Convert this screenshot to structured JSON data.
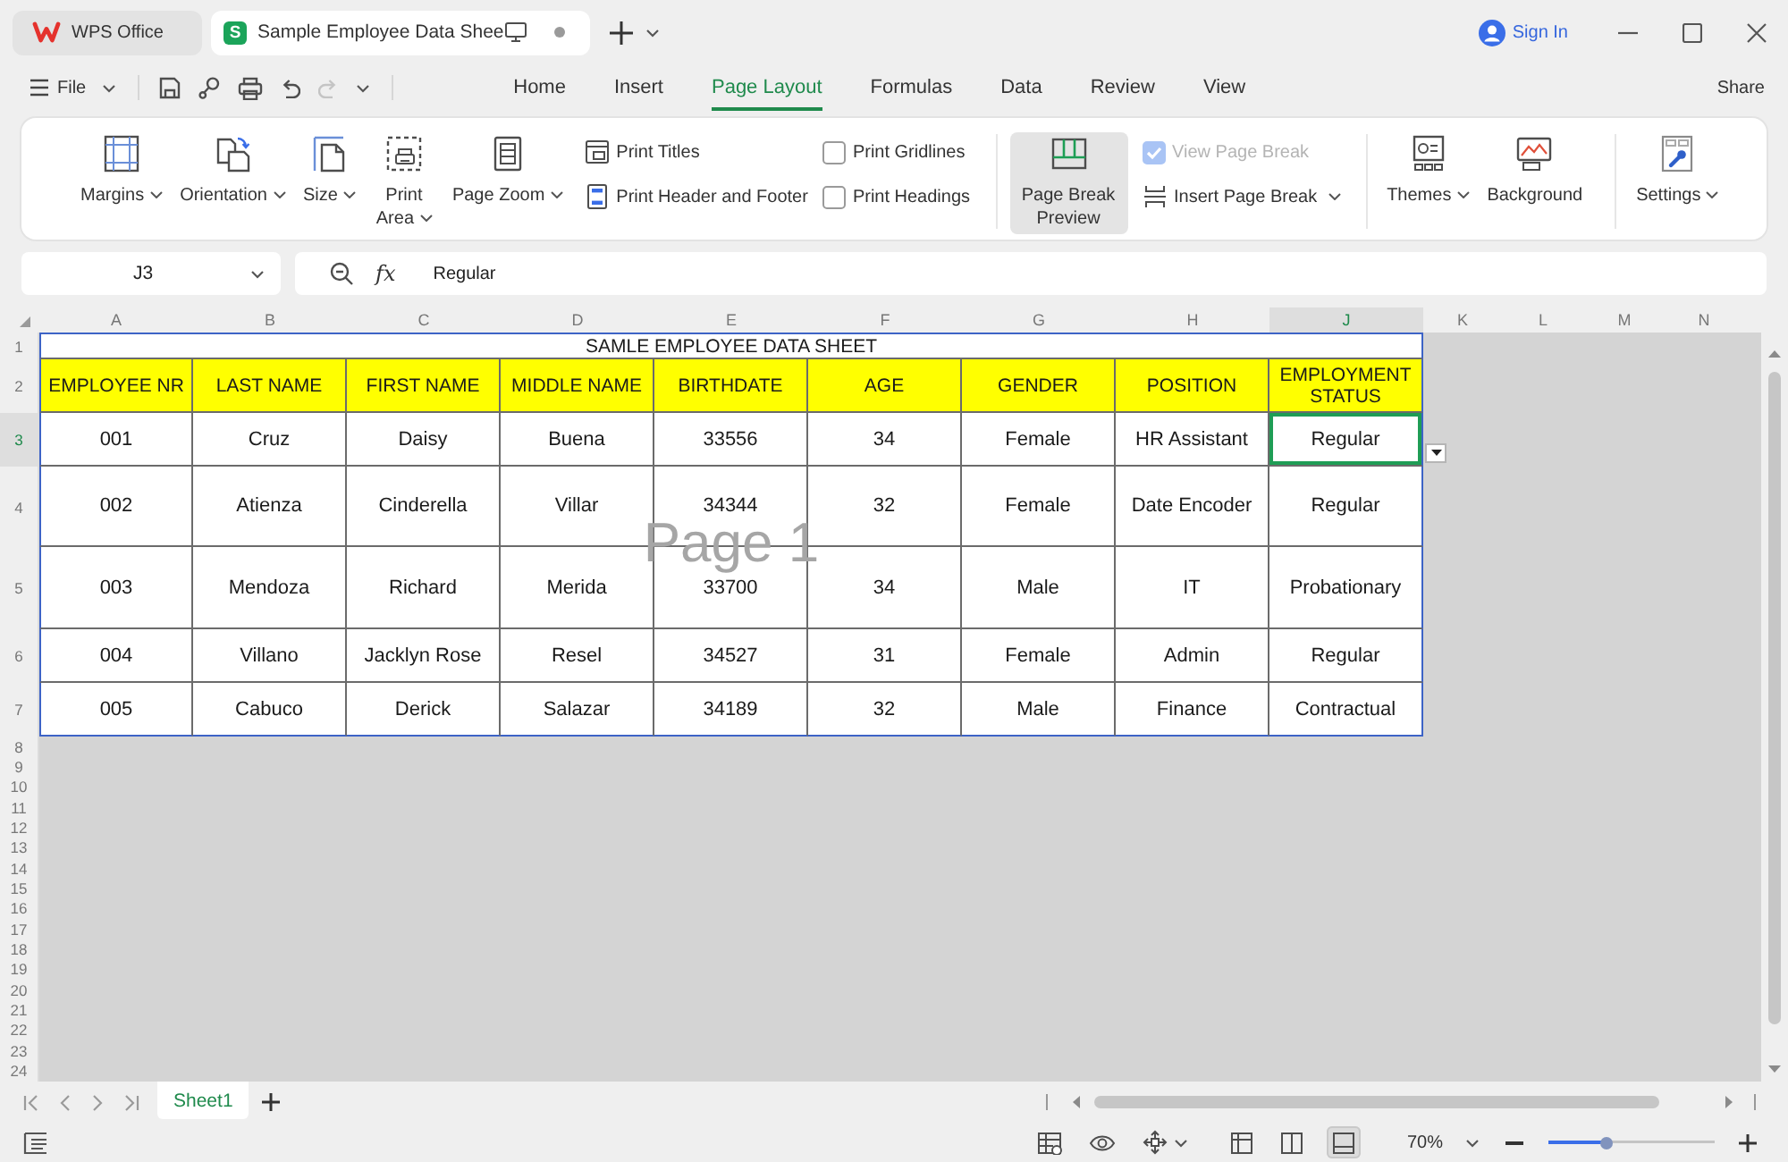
{
  "title_bar": {
    "tabs": [
      {
        "kind": "home",
        "label": "WPS Office",
        "selected": false
      },
      {
        "kind": "document",
        "badge": "S",
        "label": "Sample Employee Data Shee",
        "unsaved": true,
        "selected": true
      }
    ],
    "account": "Sign In"
  },
  "menu_bar": {
    "file": "File",
    "quick_access": [
      {
        "disabled": false
      },
      {
        "disabled": false
      },
      {
        "disabled": false
      },
      {
        "disabled": false
      },
      {
        "disabled": true
      }
    ],
    "tabs": [
      {
        "label": "Home",
        "selected": false
      },
      {
        "label": "Insert",
        "selected": false
      },
      {
        "label": "Page Layout",
        "selected": true
      },
      {
        "label": "Formulas",
        "selected": false
      },
      {
        "label": "Data",
        "selected": false
      },
      {
        "label": "Review",
        "selected": false
      },
      {
        "label": "View",
        "selected": false
      }
    ],
    "share": "Share"
  },
  "ribbon": {
    "sections": [
      {
        "controls": [
          {
            "kind": "large",
            "label": "Margins",
            "dropdown": true,
            "selected": false
          },
          {
            "kind": "large",
            "label": "Orientation",
            "dropdown": true,
            "selected": false
          },
          {
            "kind": "large",
            "label": "Size",
            "dropdown": true,
            "selected": false
          },
          {
            "kind": "large",
            "label": "Print Area",
            "dropdown": true,
            "selected": false
          },
          {
            "kind": "large",
            "label": "Page Zoom",
            "dropdown": true,
            "selected": false
          },
          {
            "kind": "stack",
            "items": [
              {
                "kind": "small",
                "label": "Print Titles",
                "dropdown": false
              },
              {
                "kind": "small",
                "label": "Print Header and Footer",
                "dropdown": false
              }
            ]
          },
          {
            "kind": "stack",
            "items": [
              {
                "kind": "checkbox",
                "label": "Print Gridlines",
                "checked": false,
                "disabled": false
              },
              {
                "kind": "checkbox",
                "label": "Print Headings",
                "checked": false,
                "disabled": false
              }
            ]
          }
        ]
      },
      {
        "controls": [
          {
            "kind": "large",
            "label": "Page Break Preview",
            "dropdown": false,
            "selected": true
          },
          {
            "kind": "stack",
            "items": [
              {
                "kind": "checkbox",
                "label": "View Page Break",
                "checked": true,
                "disabled": true
              },
              {
                "kind": "small",
                "label": "Insert Page Break",
                "dropdown": true
              }
            ]
          }
        ]
      },
      {
        "controls": [
          {
            "kind": "large",
            "label": "Themes",
            "dropdown": true,
            "selected": false
          },
          {
            "kind": "large",
            "label": "Background",
            "dropdown": false,
            "selected": false
          }
        ]
      },
      {
        "controls": [
          {
            "kind": "large",
            "label": "Settings",
            "dropdown": true,
            "selected": false
          }
        ]
      }
    ]
  },
  "formula_bar": {
    "cell_name": "J3",
    "function_label": "fx",
    "value": "Regular"
  },
  "sheet": {
    "columns": [
      {
        "label": "A",
        "selected": false
      },
      {
        "label": "B",
        "selected": false
      },
      {
        "label": "C",
        "selected": false
      },
      {
        "label": "D",
        "selected": false
      },
      {
        "label": "E",
        "selected": false
      },
      {
        "label": "F",
        "selected": false
      },
      {
        "label": "G",
        "selected": false
      },
      {
        "label": "H",
        "selected": false
      },
      {
        "label": "J",
        "selected": true
      },
      {
        "label": "K",
        "selected": false
      },
      {
        "label": "L",
        "selected": false
      },
      {
        "label": "M",
        "selected": false
      },
      {
        "label": "N",
        "selected": false
      }
    ],
    "rows": [
      {
        "label": "1",
        "selected": false
      },
      {
        "label": "2",
        "selected": false
      },
      {
        "label": "3",
        "selected": true
      },
      {
        "label": "4",
        "selected": false
      },
      {
        "label": "5",
        "selected": false
      },
      {
        "label": "6",
        "selected": false
      },
      {
        "label": "7",
        "selected": false
      },
      {
        "label": "8",
        "selected": false
      },
      {
        "label": "9",
        "selected": false
      },
      {
        "label": "10",
        "selected": false
      },
      {
        "label": "11",
        "selected": false
      },
      {
        "label": "12",
        "selected": false
      },
      {
        "label": "13",
        "selected": false
      },
      {
        "label": "14",
        "selected": false
      },
      {
        "label": "15",
        "selected": false
      },
      {
        "label": "16",
        "selected": false
      },
      {
        "label": "17",
        "selected": false
      },
      {
        "label": "18",
        "selected": false
      },
      {
        "label": "19",
        "selected": false
      },
      {
        "label": "20",
        "selected": false
      },
      {
        "label": "21",
        "selected": false
      },
      {
        "label": "22",
        "selected": false
      },
      {
        "label": "23",
        "selected": false
      },
      {
        "label": "24",
        "selected": false
      }
    ],
    "title": "SAMLE EMPLOYEE DATA SHEET",
    "header": [
      "EMPLOYEE NR",
      "LAST NAME",
      "FIRST NAME",
      "MIDDLE NAME",
      "BIRTHDATE",
      "AGE",
      "GENDER",
      "POSITION",
      "EMPLOYMENT STATUS"
    ],
    "records": [
      {
        "cells": [
          {
            "text": "001",
            "selected": false
          },
          {
            "text": "Cruz",
            "selected": false
          },
          {
            "text": "Daisy",
            "selected": false
          },
          {
            "text": "Buena",
            "selected": false
          },
          {
            "text": "33556",
            "selected": false
          },
          {
            "text": "34",
            "selected": false
          },
          {
            "text": "Female",
            "selected": false
          },
          {
            "text": "HR Assistant",
            "selected": false
          },
          {
            "text": "Regular",
            "selected": true
          }
        ]
      },
      {
        "cells": [
          {
            "text": "002",
            "selected": false
          },
          {
            "text": "Atienza",
            "selected": false
          },
          {
            "text": "Cinderella",
            "selected": false
          },
          {
            "text": "Villar",
            "selected": false
          },
          {
            "text": "34344",
            "selected": false
          },
          {
            "text": "32",
            "selected": false
          },
          {
            "text": "Female",
            "selected": false
          },
          {
            "text": "Date Encoder",
            "selected": false
          },
          {
            "text": "Regular",
            "selected": false
          }
        ]
      },
      {
        "cells": [
          {
            "text": "003",
            "selected": false
          },
          {
            "text": "Mendoza",
            "selected": false
          },
          {
            "text": "Richard",
            "selected": false
          },
          {
            "text": "Merida",
            "selected": false
          },
          {
            "text": "33700",
            "selected": false
          },
          {
            "text": "34",
            "selected": false
          },
          {
            "text": "Male",
            "selected": false
          },
          {
            "text": "IT",
            "selected": false
          },
          {
            "text": "Probationary",
            "selected": false
          }
        ]
      },
      {
        "cells": [
          {
            "text": "004",
            "selected": false
          },
          {
            "text": "Villano",
            "selected": false
          },
          {
            "text": "Jacklyn Rose",
            "selected": false
          },
          {
            "text": "Resel",
            "selected": false
          },
          {
            "text": "34527",
            "selected": false
          },
          {
            "text": "31",
            "selected": false
          },
          {
            "text": "Female",
            "selected": false
          },
          {
            "text": "Admin",
            "selected": false
          },
          {
            "text": "Regular",
            "selected": false
          }
        ]
      },
      {
        "cells": [
          {
            "text": "005",
            "selected": false
          },
          {
            "text": "Cabuco",
            "selected": false
          },
          {
            "text": "Derick",
            "selected": false
          },
          {
            "text": "Salazar",
            "selected": false
          },
          {
            "text": "34189",
            "selected": false
          },
          {
            "text": "32",
            "selected": false
          },
          {
            "text": "Male",
            "selected": false
          },
          {
            "text": "Finance",
            "selected": false
          },
          {
            "text": "Contractual",
            "selected": false
          }
        ]
      }
    ],
    "page_label": "Page 1"
  },
  "sheet_tabs": [
    {
      "label": "Sheet1",
      "selected": true
    }
  ],
  "status_bar": {
    "views": [
      {
        "selected": false
      },
      {
        "selected": false
      },
      {
        "selected": true
      }
    ],
    "zoom": "70%",
    "zoom_slider": {
      "level": 0.35
    }
  }
}
